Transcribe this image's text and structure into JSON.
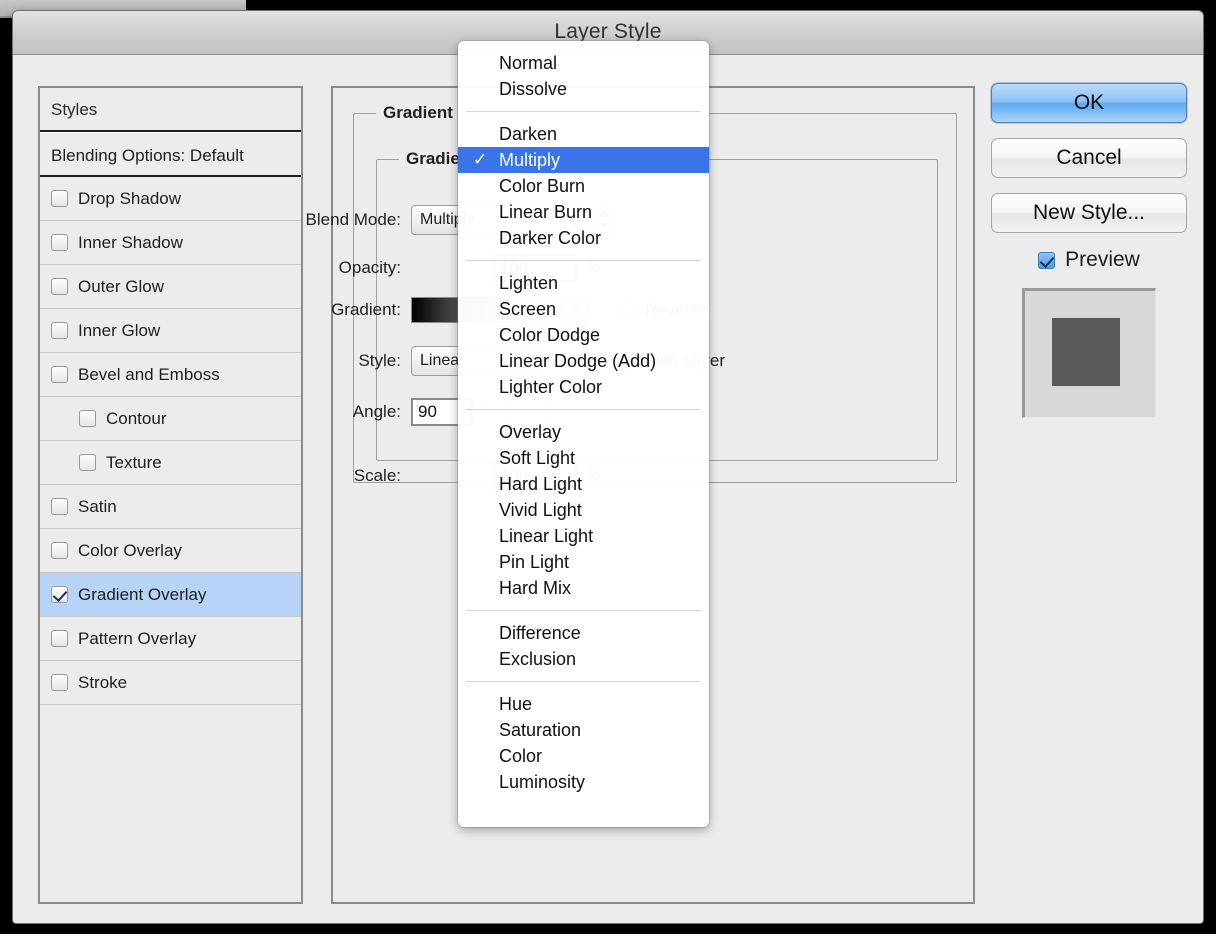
{
  "window": {
    "title": "Layer Style"
  },
  "styles_panel": {
    "header": "Styles",
    "blending_options": "Blending Options: Default",
    "items": [
      {
        "label": "Drop Shadow",
        "checked": false,
        "indent": false,
        "selected": false
      },
      {
        "label": "Inner Shadow",
        "checked": false,
        "indent": false,
        "selected": false
      },
      {
        "label": "Outer Glow",
        "checked": false,
        "indent": false,
        "selected": false
      },
      {
        "label": "Inner Glow",
        "checked": false,
        "indent": false,
        "selected": false
      },
      {
        "label": "Bevel and Emboss",
        "checked": false,
        "indent": false,
        "selected": false
      },
      {
        "label": "Contour",
        "checked": false,
        "indent": true,
        "selected": false
      },
      {
        "label": "Texture",
        "checked": false,
        "indent": true,
        "selected": false
      },
      {
        "label": "Satin",
        "checked": false,
        "indent": false,
        "selected": false
      },
      {
        "label": "Color Overlay",
        "checked": false,
        "indent": false,
        "selected": false
      },
      {
        "label": "Gradient Overlay",
        "checked": true,
        "indent": false,
        "selected": true
      },
      {
        "label": "Pattern Overlay",
        "checked": false,
        "indent": false,
        "selected": false
      },
      {
        "label": "Stroke",
        "checked": false,
        "indent": false,
        "selected": false
      }
    ]
  },
  "main_panel": {
    "group_title": "Gradient",
    "subgroup_title": "Gradient",
    "blend_mode_label": "Blend Mode:",
    "blend_mode_value": "Multiply",
    "opacity_label": "Opacity:",
    "opacity_value": "100",
    "opacity_unit": "%",
    "gradient_label": "Gradient:",
    "reverse_label": "Reverse",
    "reverse_checked": false,
    "style_label": "Style:",
    "style_value": "Linear",
    "align_label": "Align with Layer",
    "align_checked": true,
    "angle_label": "Angle:",
    "angle_value": "90",
    "angle_unit": "°",
    "scale_label": "Scale:",
    "scale_value": "100",
    "scale_unit": "%"
  },
  "buttons": {
    "ok": "OK",
    "cancel": "Cancel",
    "new_style": "New Style...",
    "preview_label": "Preview",
    "preview_checked": true
  },
  "blend_menu": {
    "selected": "Multiply",
    "groups": [
      {
        "items": [
          "Normal",
          "Dissolve"
        ]
      },
      {
        "items": [
          "Darken",
          "Multiply",
          "Color Burn",
          "Linear Burn",
          "Darker Color"
        ]
      },
      {
        "items": [
          "Lighten",
          "Screen",
          "Color Dodge",
          "Linear Dodge (Add)",
          "Lighter Color"
        ]
      },
      {
        "items": [
          "Overlay",
          "Soft Light",
          "Hard Light",
          "Vivid Light",
          "Linear Light",
          "Pin Light",
          "Hard Mix"
        ]
      },
      {
        "items": [
          "Difference",
          "Exclusion"
        ]
      },
      {
        "items": [
          "Hue",
          "Saturation",
          "Color",
          "Luminosity"
        ]
      }
    ]
  },
  "colors": {
    "selection_blue": "#b7d4f6",
    "menu_highlight": "#3a74e8",
    "dialog_bg": "#ececec",
    "preview_inner": "#595959",
    "preview_outer": "#d8d8d8"
  }
}
